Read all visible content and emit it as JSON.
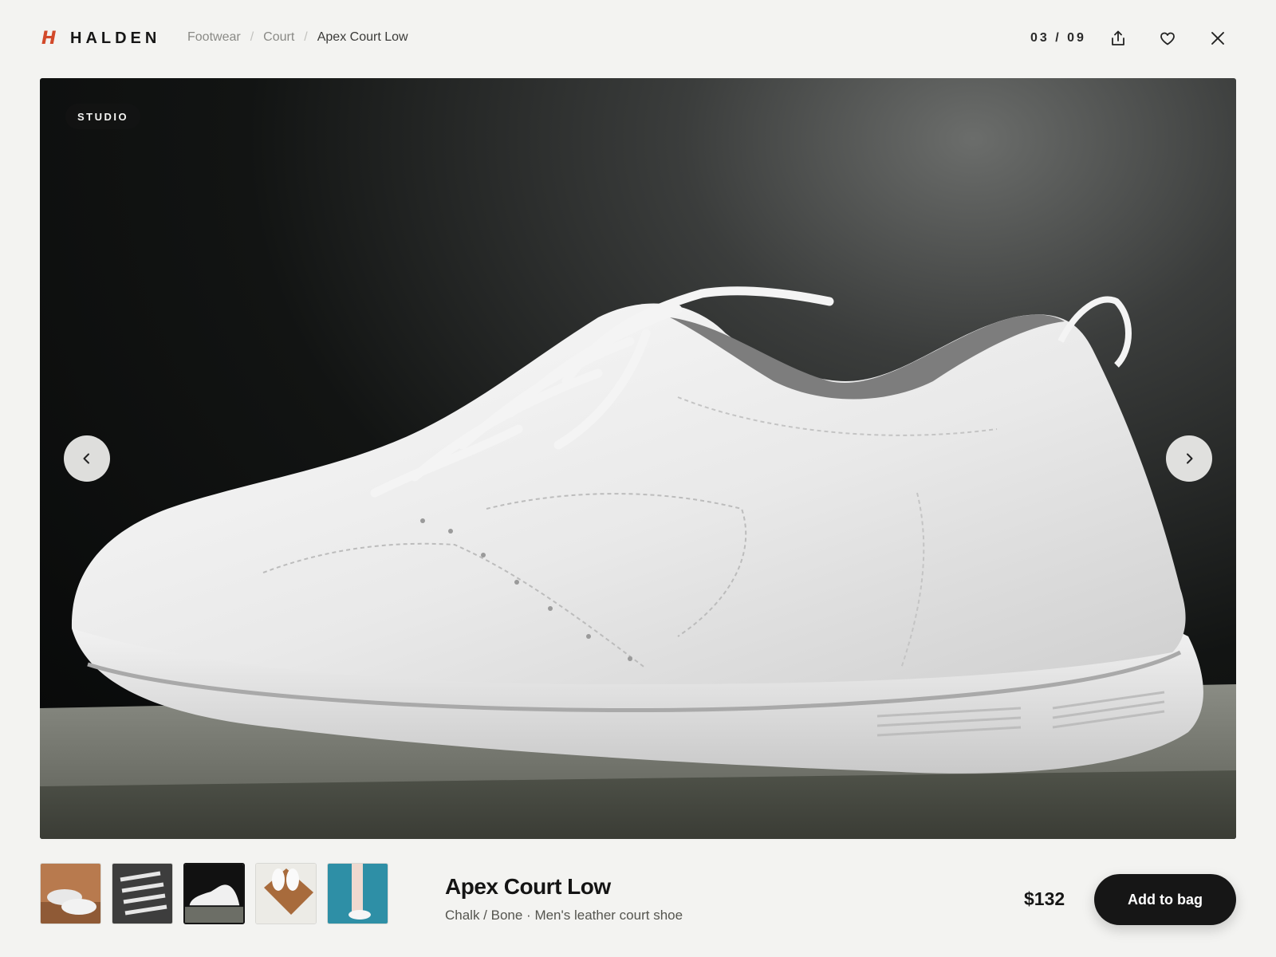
{
  "brand": {
    "logo_mark": "H",
    "name": "HALDEN",
    "accent": "#d2492a"
  },
  "breadcrumb": [
    {
      "label": "Footwear"
    },
    {
      "label": "Court"
    },
    {
      "label": "Apex Court Low"
    }
  ],
  "breadcrumb_separator": "/",
  "gallery": {
    "counter": "03 / 09",
    "current_index": 3,
    "total": 9,
    "badge": "STUDIO",
    "active_thumbnail": 3
  },
  "header_icons": {
    "share": "share-icon",
    "favorite": "heart-icon",
    "close": "close-icon"
  },
  "nav_icons": {
    "prev": "chevron-left-icon",
    "next": "chevron-right-icon"
  },
  "product": {
    "name": "Apex Court Low",
    "subtitle": "Chalk / Bone · Men's leather court shoe",
    "price": "$132",
    "add_to_bag_label": "Add to bag"
  },
  "colors": {
    "background": "#f3f3f1",
    "button": "#161616",
    "button_text": "#ffffff"
  }
}
